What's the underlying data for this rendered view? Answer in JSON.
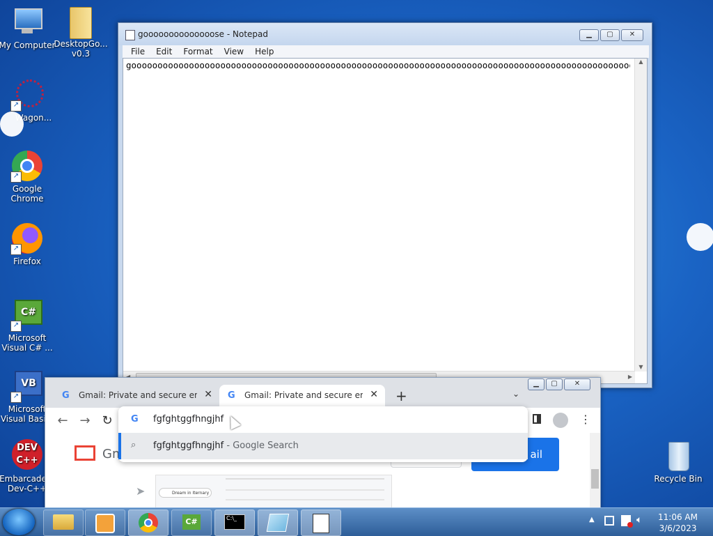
{
  "desktop": {
    "icons": [
      {
        "label": "My Computer"
      },
      {
        "label": "DesktopGo... v0.3"
      },
      {
        "label": "Wagon..."
      },
      {
        "label": "Google Chrome"
      },
      {
        "label": "Firefox"
      },
      {
        "label": "Microsoft Visual C# ..."
      },
      {
        "label": "Microsoft Visual Basi..."
      },
      {
        "label": "Embarcadero Dev-C++"
      },
      {
        "label": "Recycle Bin"
      }
    ]
  },
  "notepad": {
    "title": "goooooooooooooose - Notepad",
    "menu": [
      "File",
      "Edit",
      "Format",
      "View",
      "Help"
    ],
    "content": "goooooooooooooooooooooooooooooooooooooooooooooooooooooooooooooooooooooooooooooooooooooooooooooooooooooooooooooooooooooo"
  },
  "chrome": {
    "tabs": [
      {
        "label": "Gmail: Private and secure email a"
      },
      {
        "label": "Gmail: Private and secure email a"
      }
    ],
    "new_tab": "+",
    "omnibox_text": "fgfghtggfhngjhf",
    "suggestion_query": "fgfghtggfhngjhf",
    "suggestion_suffix": " - Google Search",
    "page_button_fragment": "ail",
    "page_logo_fragment": "Gm",
    "page_thumb_text": "Dream in Iternary"
  },
  "taskbar": {
    "time": "11:06 AM",
    "date": "3/6/2023"
  },
  "colors": {
    "accent_blue": "#1a73e8",
    "gmail_red": "#ea4335"
  }
}
